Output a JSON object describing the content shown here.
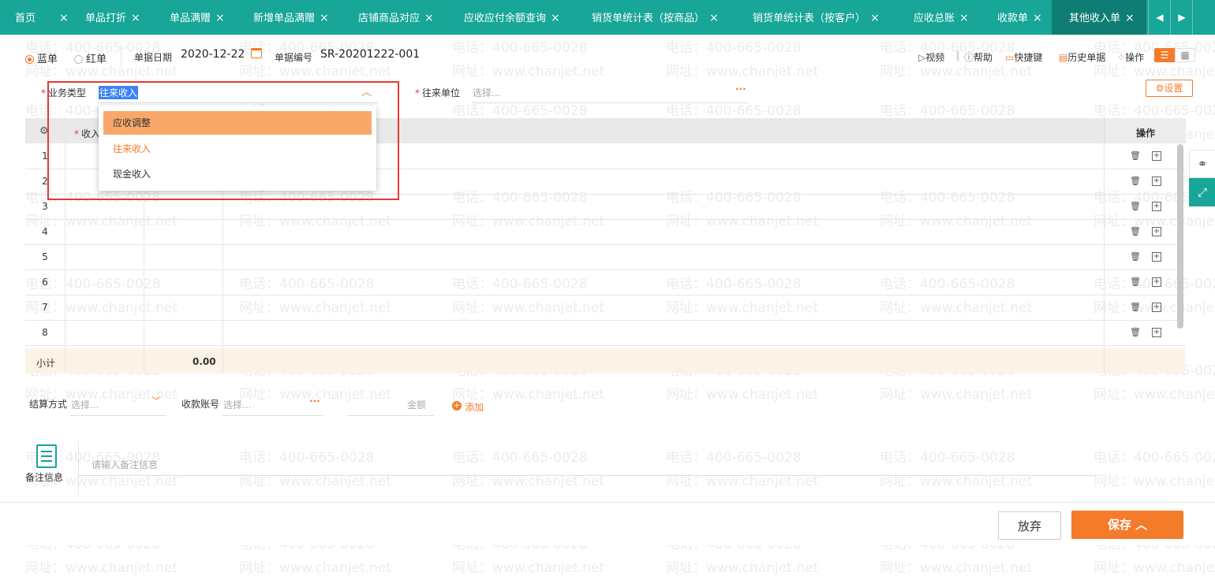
{
  "tabs": [
    {
      "label": "首页",
      "active": false
    },
    {
      "label": "单品打折",
      "active": false
    },
    {
      "label": "单品满赠",
      "active": false
    },
    {
      "label": "新增单品满赠",
      "active": false
    },
    {
      "label": "店铺商品对应",
      "active": false
    },
    {
      "label": "应收应付余额查询",
      "active": false
    },
    {
      "label": "销货单统计表（按商品）",
      "active": false
    },
    {
      "label": "销货单统计表（按客户）",
      "active": false
    },
    {
      "label": "应收总账",
      "active": false
    },
    {
      "label": "收款单",
      "active": false
    },
    {
      "label": "其他收入单",
      "active": true
    }
  ],
  "tab_close": "×",
  "tab_nav": {
    "prev": "◀",
    "next": "▶"
  },
  "watermark": {
    "phone": "电话：400-665-0028",
    "site": "网址：www.chanjet.net"
  },
  "header": {
    "radio_blue": "蓝单",
    "radio_red": "红单",
    "date_label": "单据日期",
    "date_value": "2020-12-22",
    "no_label": "单据编号",
    "no_value": "SR-20201222-001"
  },
  "toolbar": {
    "video": "视频",
    "divider": "|",
    "help": "帮助",
    "shortcut": "快捷键",
    "history": "历史单据",
    "ops": "操作",
    "settings": "设置"
  },
  "form": {
    "biz_type_label": "业务类型",
    "biz_type_value": "往来收入",
    "partner_label": "往来单位",
    "partner_placeholder": "选择...",
    "more": "···"
  },
  "dropdown": {
    "options": [
      {
        "label": "应收调整",
        "state": "hover"
      },
      {
        "label": "往来收入",
        "state": "selected"
      },
      {
        "label": "现金收入",
        "state": "normal"
      }
    ]
  },
  "grid": {
    "col_income": "收入",
    "col_ops": "操作",
    "rows": [
      "1",
      "2",
      "3",
      "4",
      "5",
      "6",
      "7",
      "8"
    ],
    "subtotal_label": "小计",
    "subtotal_value": "0.00"
  },
  "settlement": {
    "method_label": "结算方式",
    "method_placeholder": "选择...",
    "account_label": "收款账号",
    "account_placeholder": "选择...",
    "amount_label": "金额",
    "add_label": "添加"
  },
  "remarks": {
    "label": "备注信息",
    "placeholder": "请输入备注信息"
  },
  "footer": {
    "discard": "放弃",
    "save": "保存"
  },
  "colors": {
    "teal": "#17a697",
    "orange": "#f47b2a",
    "red": "#e53935"
  }
}
